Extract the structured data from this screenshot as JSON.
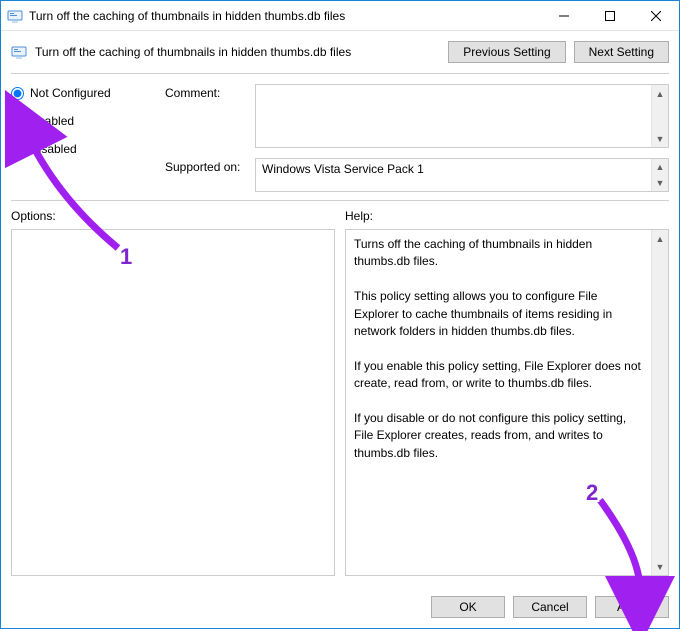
{
  "window": {
    "title": "Turn off the caching of thumbnails in hidden thumbs.db files"
  },
  "header": {
    "heading": "Turn off the caching of thumbnails in hidden thumbs.db files",
    "prev_label": "Previous Setting",
    "next_label": "Next Setting"
  },
  "radios": {
    "not_configured": "Not Configured",
    "enabled": "Enabled",
    "disabled": "Disabled",
    "selected": "not_configured"
  },
  "fields": {
    "comment_label": "Comment:",
    "comment_value": "",
    "supported_label": "Supported on:",
    "supported_value": "Windows Vista Service Pack 1"
  },
  "lower": {
    "options_label": "Options:",
    "help_label": "Help:",
    "help_text": "Turns off the caching of thumbnails in hidden thumbs.db files.\n\nThis policy setting allows you to configure File Explorer to cache thumbnails of items residing in network folders in hidden thumbs.db files.\n\nIf you enable this policy setting, File Explorer does not create, read from, or write to thumbs.db files.\n\nIf you disable or do not configure this policy setting, File Explorer creates, reads from, and writes to thumbs.db files."
  },
  "footer": {
    "ok": "OK",
    "cancel": "Cancel",
    "apply": "Apply"
  },
  "annotations": {
    "one": "1",
    "two": "2"
  }
}
